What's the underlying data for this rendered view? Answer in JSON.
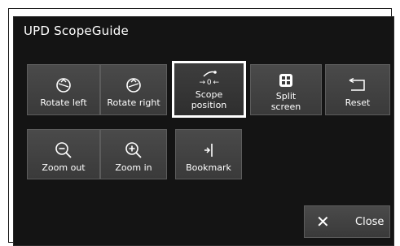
{
  "window": {
    "title": "UPD ScopeGuide"
  },
  "buttons": {
    "rotate_left": {
      "label": "Rotate left"
    },
    "rotate_right": {
      "label": "Rotate right"
    },
    "scope_position": {
      "label_line1": "Scope",
      "label_line2": "position"
    },
    "split_screen": {
      "label_line1": "Split",
      "label_line2": "screen"
    },
    "reset": {
      "label": "Reset"
    },
    "zoom_out": {
      "label": "Zoom out"
    },
    "zoom_in": {
      "label": "Zoom in"
    },
    "bookmark": {
      "label": "Bookmark"
    },
    "close": {
      "label": "Close",
      "icon": "✕"
    }
  },
  "icons": {
    "scope_position_arrows": "→ 0 ←"
  },
  "colors": {
    "panel_bg": "#141414",
    "button_bg": "#444444",
    "selected_outline": "#ffffff",
    "text": "#ffffff"
  }
}
